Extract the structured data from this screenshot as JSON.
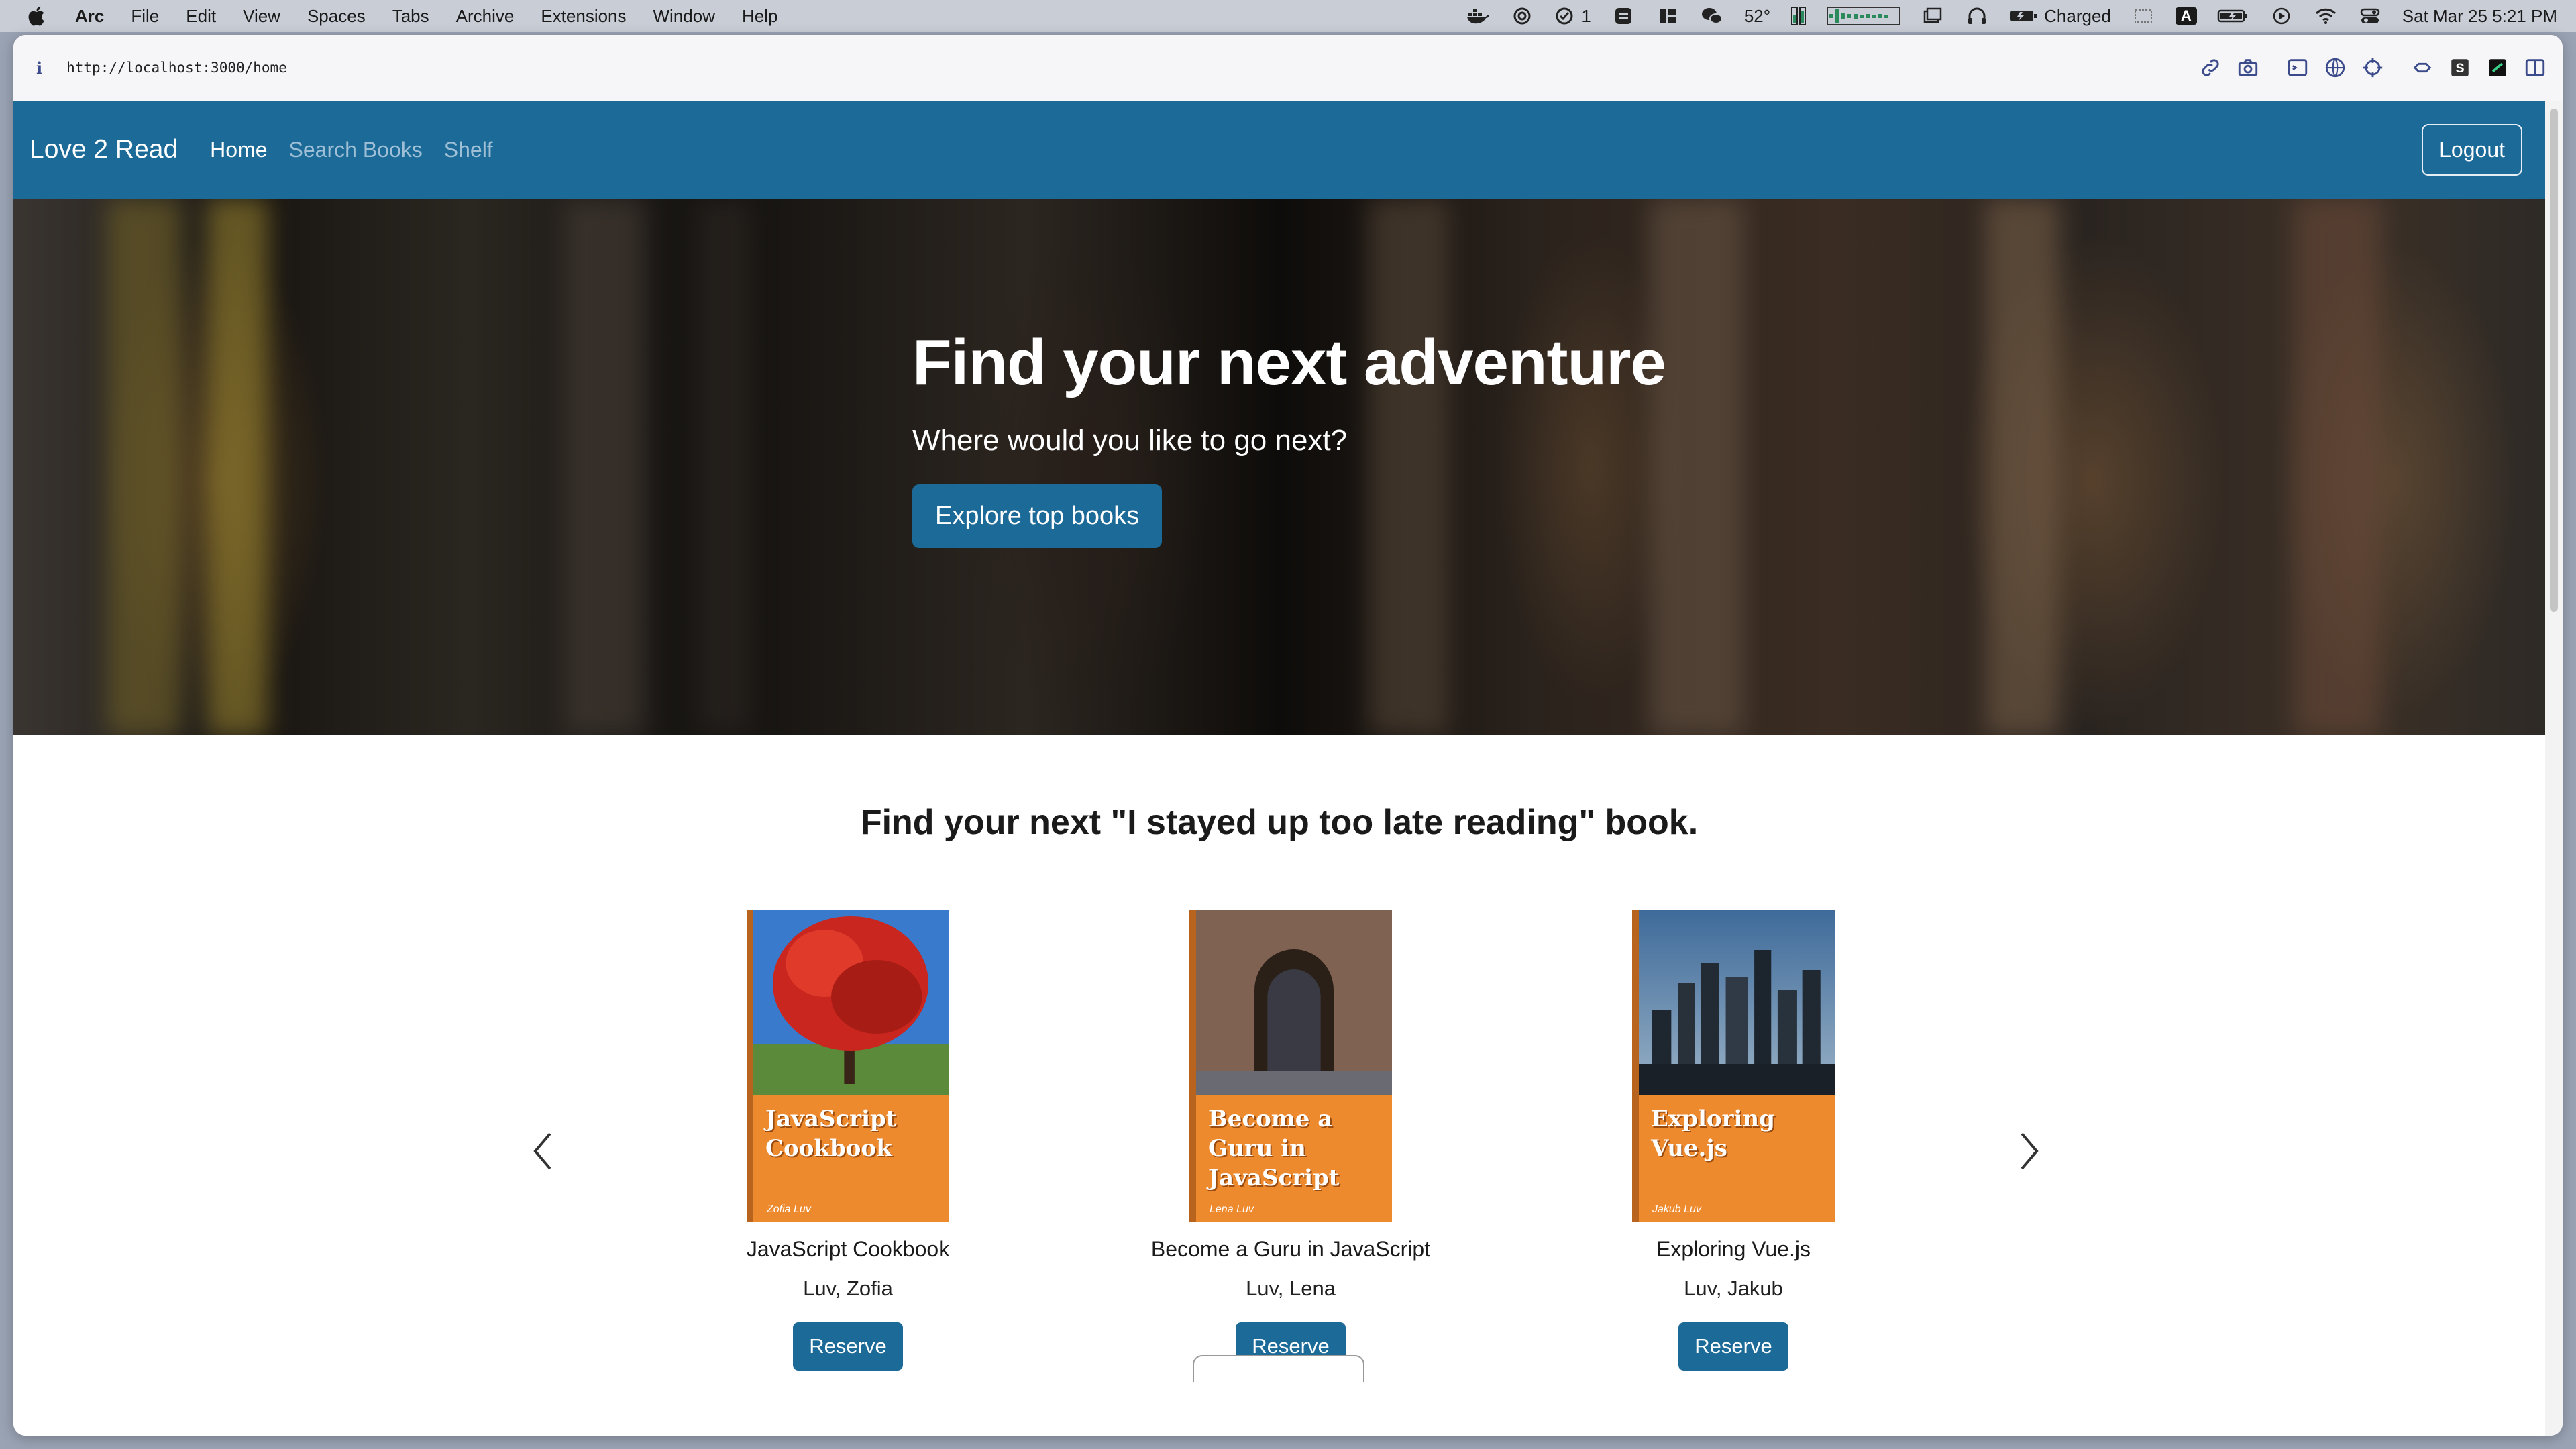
{
  "menubar": {
    "app": "Arc",
    "items": [
      "File",
      "Edit",
      "View",
      "Spaces",
      "Tabs",
      "Archive",
      "Extensions",
      "Window",
      "Help"
    ],
    "status": {
      "updates_count": "1",
      "temperature": "52°",
      "battery_label": "Charged",
      "keyboard": "A",
      "datetime": "Sat Mar 25  5:21 PM"
    }
  },
  "browser": {
    "url": "http://localhost:3000/home"
  },
  "navbar": {
    "brand": "Love 2 Read",
    "links": [
      "Home",
      "Search Books",
      "Shelf"
    ],
    "logout": "Logout"
  },
  "hero": {
    "title": "Find your next adventure",
    "subtitle": "Where would you like to go next?",
    "button": "Explore top books"
  },
  "books_section": {
    "title": "Find your next \"I stayed up too late reading\" book.",
    "reserve_label": "Reserve",
    "books": [
      {
        "cover_title": "JavaScript Cookbook",
        "cover_author": "Zofia Luv",
        "title": "JavaScript Cookbook",
        "author": "Luv, Zofia"
      },
      {
        "cover_title": "Become a Guru in JavaScript",
        "cover_author": "Lena Luv",
        "title": "Become a Guru in JavaScript",
        "author": "Luv, Lena"
      },
      {
        "cover_title": "Exploring Vue.js",
        "cover_author": "Jakub Luv",
        "title": "Exploring Vue.js",
        "author": "Luv, Jakub"
      }
    ]
  },
  "colors": {
    "primary": "#1c6a98",
    "cover_orange": "#ee8a2e"
  }
}
